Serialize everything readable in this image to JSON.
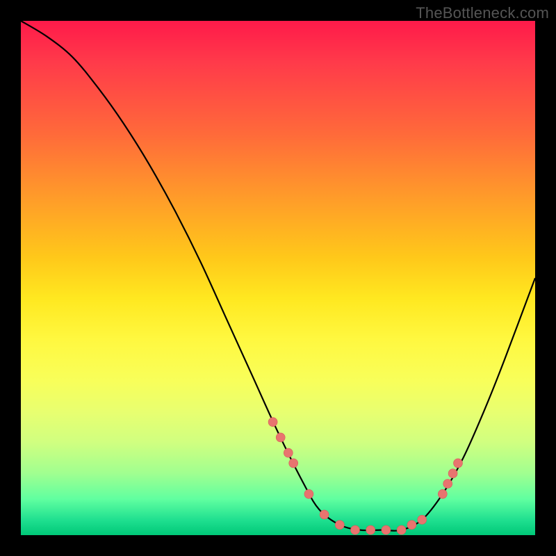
{
  "watermark": "TheBottleneck.com",
  "chart_data": {
    "type": "line",
    "title": "",
    "xlabel": "",
    "ylabel": "",
    "xlim": [
      0,
      100
    ],
    "ylim": [
      0,
      100
    ],
    "grid": false,
    "legend": false,
    "series": [
      {
        "name": "curve",
        "x": [
          0,
          5,
          10,
          15,
          20,
          25,
          30,
          35,
          40,
          45,
          50,
          55,
          58,
          62,
          66,
          70,
          74,
          78,
          82,
          86,
          90,
          94,
          100
        ],
        "y": [
          100,
          97,
          93,
          87,
          80,
          72,
          63,
          53,
          42,
          31,
          20,
          10,
          5,
          2,
          1,
          1,
          1,
          3,
          8,
          15,
          24,
          34,
          50
        ]
      }
    ],
    "points": {
      "name": "dots",
      "x": [
        49,
        50.5,
        52,
        53,
        56,
        59,
        62,
        65,
        68,
        71,
        74,
        76,
        78,
        82,
        83,
        84,
        85
      ],
      "y": [
        22,
        19,
        16,
        14,
        8,
        4,
        2,
        1,
        1,
        1,
        1,
        2,
        3,
        8,
        10,
        12,
        14
      ]
    }
  }
}
